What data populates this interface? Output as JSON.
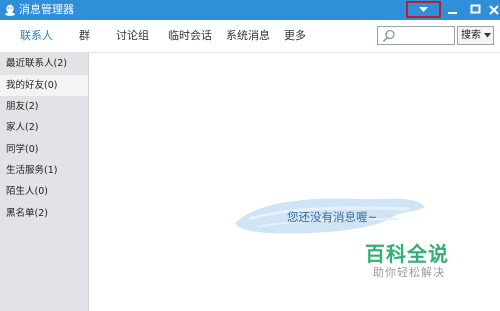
{
  "window": {
    "title": "消息管理器",
    "title_bar_color": "#2f8fd9",
    "controls": [
      "chevron-down-icon",
      "minimize-icon",
      "maximize-icon",
      "close-icon"
    ]
  },
  "tabs": [
    {
      "label": "联系人",
      "active": true
    },
    {
      "label": "群",
      "active": false
    },
    {
      "label": "讨论组",
      "active": false
    },
    {
      "label": "临时会话",
      "active": false
    },
    {
      "label": "系统消息",
      "active": false
    },
    {
      "label": "更多",
      "active": false
    }
  ],
  "search": {
    "placeholder": "",
    "button_label": "搜索",
    "icon": "search-icon"
  },
  "sidebar": {
    "items": [
      {
        "label": "最近联系人(2)",
        "active": false
      },
      {
        "label": "我的好友(0)",
        "active": true
      },
      {
        "label": "朋友(2)",
        "active": false
      },
      {
        "label": "家人(2)",
        "active": false
      },
      {
        "label": "同学(0)",
        "active": false
      },
      {
        "label": "生活服务(1)",
        "active": false
      },
      {
        "label": "陌生人(0)",
        "active": false
      },
      {
        "label": "黑名单(2)",
        "active": false
      }
    ]
  },
  "main": {
    "empty_message": "您还没有消息喔~"
  },
  "watermark": {
    "logo": "百科全说",
    "subtitle": "助你轻松解决",
    "color": "#2fb171"
  }
}
